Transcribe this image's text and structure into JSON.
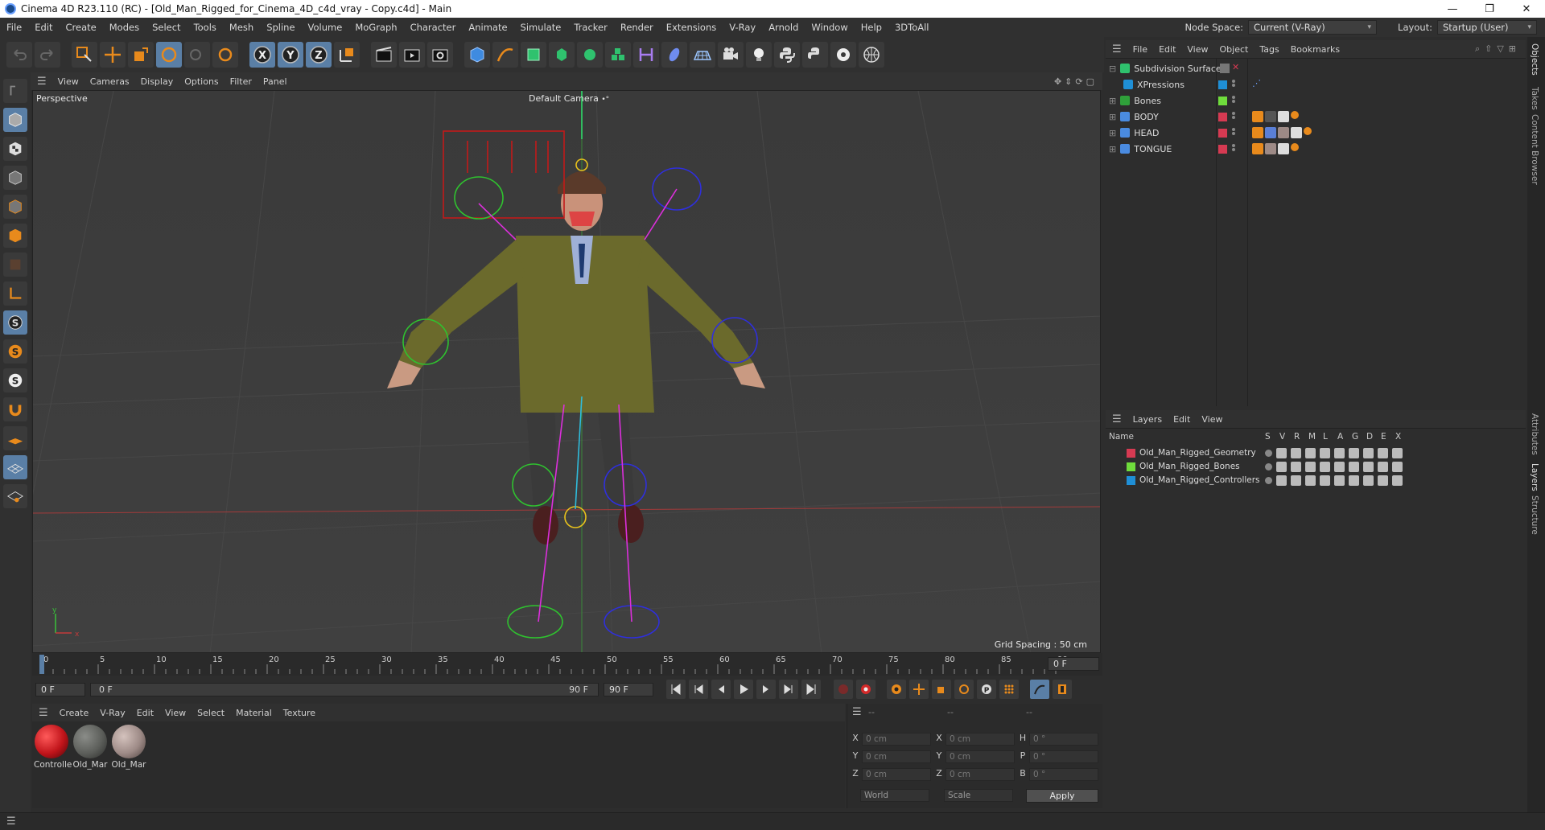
{
  "window": {
    "title": "Cinema 4D R23.110 (RC) - [Old_Man_Rigged_for_Cinema_4D_c4d_vray - Copy.c4d] - Main",
    "controls": [
      "—",
      "❐",
      "✕"
    ]
  },
  "menubar": {
    "items": [
      "File",
      "Edit",
      "Create",
      "Modes",
      "Select",
      "Tools",
      "Mesh",
      "Spline",
      "Volume",
      "MoGraph",
      "Character",
      "Animate",
      "Simulate",
      "Tracker",
      "Render",
      "Extensions",
      "V-Ray",
      "Arnold",
      "Window",
      "Help",
      "3DToAll"
    ],
    "node_space_label": "Node Space:",
    "node_space_value": "Current (V-Ray)",
    "layout_label": "Layout:",
    "layout_value": "Startup (User)"
  },
  "viewport": {
    "menu": [
      "View",
      "Cameras",
      "Display",
      "Options",
      "Filter",
      "Panel"
    ],
    "view_name": "Perspective",
    "camera_name": "Default Camera",
    "camera_suffix": "•°",
    "grid_spacing": "Grid Spacing : 50 cm",
    "axis_y": "y",
    "axis_x": "x"
  },
  "timeline": {
    "ticks": [
      "0",
      "5",
      "10",
      "15",
      "20",
      "25",
      "30",
      "35",
      "40",
      "45",
      "50",
      "55",
      "60",
      "65",
      "70",
      "75",
      "80",
      "85",
      "90"
    ],
    "current_frame": "0 F",
    "start_field": "0 F",
    "range_start": "0 F",
    "range_end": "90 F",
    "end_field": "90 F"
  },
  "material_manager": {
    "menu": [
      "Create",
      "V-Ray",
      "Edit",
      "View",
      "Select",
      "Material",
      "Texture"
    ],
    "materials": [
      {
        "name": "Controlle",
        "color": "#c0141a"
      },
      {
        "name": "Old_Mar",
        "color": "#5c5e5a"
      },
      {
        "name": "Old_Mar",
        "color": "#9d8a86"
      }
    ]
  },
  "coordinates": {
    "header": [
      "--",
      "--",
      "--"
    ],
    "rows": [
      {
        "a": "X",
        "av": "0 cm",
        "b": "X",
        "bv": "0 cm",
        "c": "H",
        "cv": "0 °"
      },
      {
        "a": "Y",
        "av": "0 cm",
        "b": "Y",
        "bv": "0 cm",
        "c": "P",
        "cv": "0 °"
      },
      {
        "a": "Z",
        "av": "0 cm",
        "b": "Z",
        "bv": "0 cm",
        "c": "B",
        "cv": "0 °"
      }
    ],
    "space": "World",
    "mode": "Scale",
    "apply": "Apply"
  },
  "object_manager": {
    "menu": [
      "File",
      "Edit",
      "View",
      "Object",
      "Tags",
      "Bookmarks"
    ],
    "objects": [
      {
        "name": "Subdivision Surface",
        "color": "",
        "icon": "subdivision-icon"
      },
      {
        "name": "XPressions",
        "color": "#1f8fd6",
        "icon": "xpresso-icon"
      },
      {
        "name": "Bones",
        "color": "#6fdc3c",
        "icon": "bone-icon"
      },
      {
        "name": "BODY",
        "color": "#d63a52",
        "icon": "polygon-icon"
      },
      {
        "name": "HEAD",
        "color": "#d63a52",
        "icon": "polygon-icon"
      },
      {
        "name": "TONGUE",
        "color": "#d63a52",
        "icon": "polygon-icon"
      }
    ]
  },
  "layers": {
    "menu": [
      "Layers",
      "Edit",
      "View"
    ],
    "columns": [
      "Name",
      "S",
      "V",
      "R",
      "M",
      "L",
      "A",
      "G",
      "D",
      "E",
      "X"
    ],
    "items": [
      {
        "name": "Old_Man_Rigged_Geometry",
        "color": "#d63a52"
      },
      {
        "name": "Old_Man_Rigged_Bones",
        "color": "#6fdc3c"
      },
      {
        "name": "Old_Man_Rigged_Controllers",
        "color": "#1f8fd6"
      }
    ]
  },
  "side_tabs": [
    "Objects",
    "Takes",
    "Content Browser",
    "Attributes",
    "Layers",
    "Structure"
  ]
}
